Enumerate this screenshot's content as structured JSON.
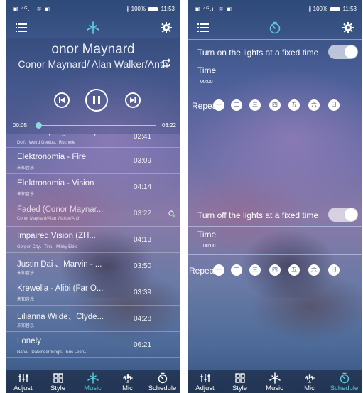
{
  "left": {
    "status": {
      "left": "▣ ⁴ᴳ.ıl ≋ ▣",
      "bt": "∦",
      "battery_pct": "100%",
      "time": "11:53"
    },
    "player": {
      "title": "onor Maynard",
      "artist": "Conor Maynard/ Alan Walker/Anth",
      "current_time": "00:05",
      "total_time": "03:22",
      "progress": 0.025
    },
    "songs": [
      {
        "name": "Dreams (Original Mix)",
        "sub": "Dolf、Weird Genius、Rochelle",
        "dur": "02:41"
      },
      {
        "name": "Elektronomia - Fire",
        "sub": "未知音乐",
        "dur": "03:09"
      },
      {
        "name": "Elektronomia - Vision",
        "sub": "未知音乐",
        "dur": "04:14"
      },
      {
        "name": "Faded (Conor Maynar...",
        "sub": "Conor Maynard/Alan Walker/Anth",
        "dur": "03:22"
      },
      {
        "name": "Impaired Vision (ZH...",
        "sub": "Gorgon City、Tink、Mikky Ekko",
        "dur": "04:13"
      },
      {
        "name": "Justin Dai 、Marvin - ...",
        "sub": "未知音乐",
        "dur": "03:50"
      },
      {
        "name": "Krewella - Alibi (Far O...",
        "sub": "未知音乐",
        "dur": "03:39"
      },
      {
        "name": "Lilianna Wilde、Clyde...",
        "sub": "未知音乐",
        "dur": "04:28"
      },
      {
        "name": "Lonely",
        "sub": "Nana、Dalvinder Singh、Eric Leon...",
        "dur": "06:21"
      }
    ],
    "active_song": 3
  },
  "right": {
    "status": {
      "left": "▣ ⁴ᴳ.ıl ≋ ▣",
      "bt": "∦",
      "battery_pct": "100%",
      "time": "11:53"
    },
    "on_section": {
      "label": "Turn on the lights at a fixed time",
      "time_label": "Time",
      "time_value": "00:00",
      "repeat_label": "Repeat"
    },
    "off_section": {
      "label": "Turn off the lights at a fixed time",
      "time_label": "Time",
      "time_value": "00:00",
      "repeat_label": "Repeat"
    },
    "days": [
      "一",
      "二",
      "三",
      "四",
      "五",
      "六",
      "日"
    ]
  },
  "nav": {
    "items": [
      {
        "label": "Adjust",
        "icon": "equalizer-icon"
      },
      {
        "label": "Style",
        "icon": "grid-icon"
      },
      {
        "label": "Music",
        "icon": "music-icon"
      },
      {
        "label": "Mic",
        "icon": "mic-icon"
      },
      {
        "label": "Schedule",
        "icon": "timer-icon"
      }
    ],
    "left_active": 2,
    "right_active": 4
  },
  "colors": {
    "accent": "#5ec8d6",
    "divider": "#c8dcff"
  }
}
